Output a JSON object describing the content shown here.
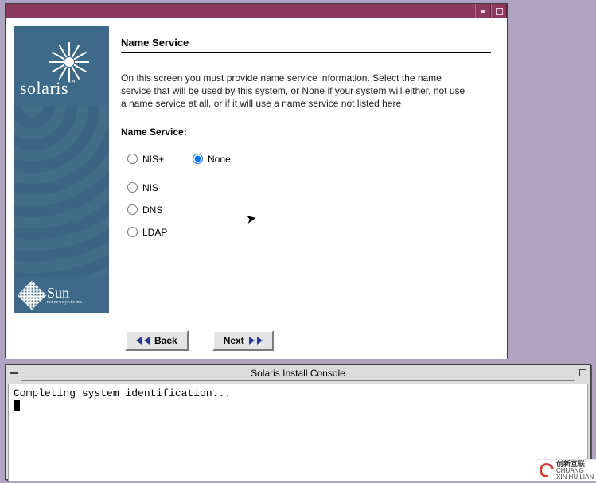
{
  "installer": {
    "branding": {
      "product": "solaris",
      "vendor": "Sun",
      "vendor_sub": "microsystems"
    },
    "heading": "Name Service",
    "description": "On this screen you must provide name service information.  Select the name service that will be used by this system, or None if your system will either, not use a name service at all, or if it will use a name service not listed here",
    "field_label": "Name Service:",
    "options": {
      "nis_plus": "NIS+",
      "none": "None",
      "nis": "NIS",
      "dns": "DNS",
      "ldap": "LDAP"
    },
    "selected": "none",
    "buttons": {
      "back": "Back",
      "next": "Next"
    }
  },
  "console": {
    "title": "Solaris Install Console",
    "line1": "Completing system identification..."
  },
  "watermark": {
    "top": "创新互联",
    "bottom": "CHUANG XIN HU LIAN"
  }
}
